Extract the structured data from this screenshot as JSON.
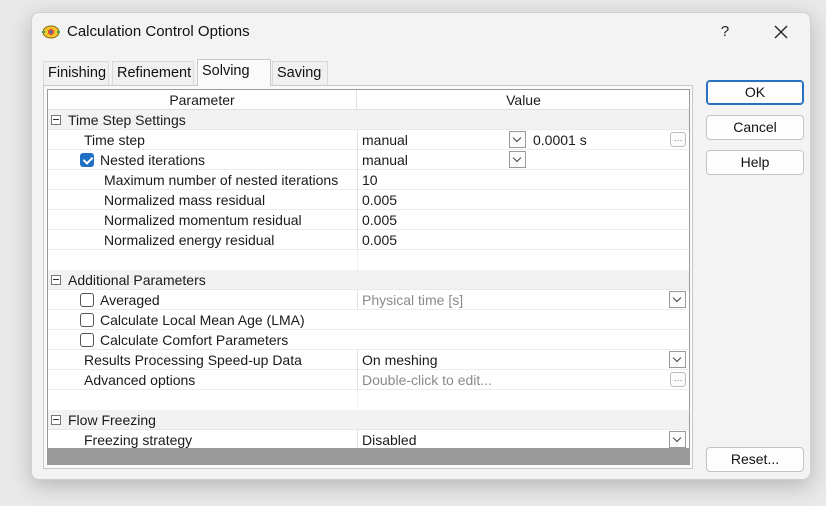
{
  "dialog": {
    "title": "Calculation Control Options",
    "help_glyph": "?",
    "icons": {
      "app": "calculator-app-icon",
      "help": "question-mark-icon",
      "close": "close-icon"
    }
  },
  "tabs": [
    "Finishing",
    "Refinement",
    "Solving",
    "Saving"
  ],
  "active_tab": "Solving",
  "grid": {
    "headers": {
      "parameter": "Parameter",
      "value": "Value"
    },
    "time_step_settings": {
      "label": "Time Step Settings",
      "time_step": {
        "label": "Time step",
        "mode": "manual",
        "value": "0.0001 s"
      },
      "nested_iterations": {
        "label": "Nested iterations",
        "checked": true,
        "value": "manual"
      },
      "max_nested": {
        "label": "Maximum number of nested iterations",
        "value": "10"
      },
      "mass_residual": {
        "label": "Normalized mass residual",
        "value": "0.005"
      },
      "momentum_residual": {
        "label": "Normalized momentum residual",
        "value": "0.005"
      },
      "energy_residual": {
        "label": "Normalized energy residual",
        "value": "0.005"
      }
    },
    "additional_parameters": {
      "label": "Additional Parameters",
      "averaged": {
        "label": "Averaged",
        "checked": false,
        "value": "Physical time [s]"
      },
      "lma": {
        "label": "Calculate Local Mean Age (LMA)",
        "checked": false
      },
      "comfort": {
        "label": "Calculate Comfort Parameters",
        "checked": false
      },
      "speedup": {
        "label": "Results Processing Speed-up Data",
        "value": "On meshing"
      },
      "advanced": {
        "label": "Advanced options",
        "value": "Double-click to edit..."
      }
    },
    "flow_freezing": {
      "label": "Flow Freezing",
      "strategy": {
        "label": "Freezing strategy",
        "value": "Disabled"
      }
    }
  },
  "buttons": {
    "ok": "OK",
    "cancel": "Cancel",
    "help": "Help",
    "reset": "Reset..."
  },
  "colors": {
    "accent": "#1f6fc5",
    "default_button_border": "#2a6fc0"
  }
}
